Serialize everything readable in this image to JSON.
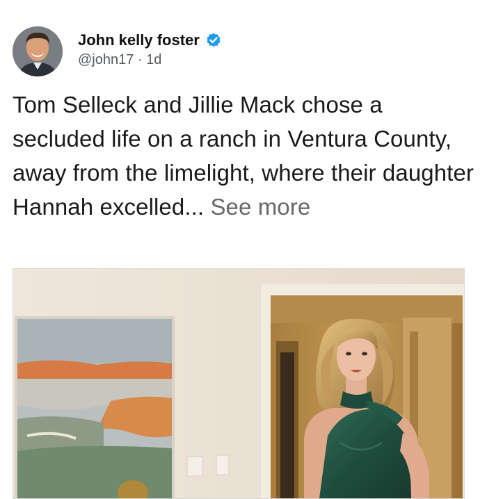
{
  "post": {
    "author_name": "John kelly foster",
    "handle": "@john17",
    "separator": "·",
    "age": "1d",
    "text": "Tom Selleck and Jillie Mack chose a secluded life on a ranch in Ventura County, away from the limelight, where their daughter Hannah excelled...",
    "see_more": "See more"
  },
  "icons": {
    "verified": "verified-badge-icon"
  },
  "colors": {
    "verified_blue": "#1d9bf0",
    "secondary_text": "#65676b"
  }
}
